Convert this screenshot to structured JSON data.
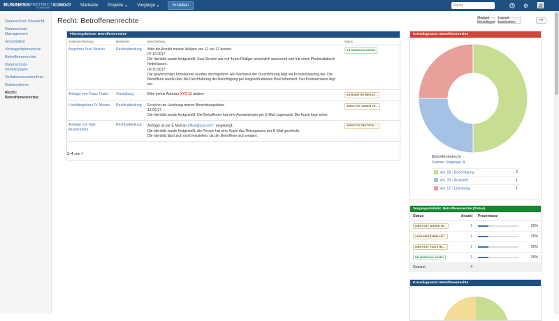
{
  "topbar": {
    "logo_main": "BUSINESS",
    "logo_thin": "PROTECT",
    "logo_sub": "by eXtrapolate",
    "brand": "KOMDAT",
    "nav": [
      {
        "label": "Startseite"
      },
      {
        "label": "Projekte"
      },
      {
        "label": "Vorgänge"
      }
    ],
    "create_label": "Erstellen",
    "search_placeholder": "Suche",
    "help_icon": "?",
    "settings_icon": "⚙"
  },
  "sidebar": {
    "items": [
      {
        "label": "Datenschutz Übersicht"
      },
      {
        "label": "Datenschutz-Management"
      },
      {
        "label": "Grundsätze"
      },
      {
        "label": "Vertragsdatenschutz"
      },
      {
        "label": "Betroffenenrechte"
      },
      {
        "label": "Datenschutz-Verletzungen"
      },
      {
        "label": "Verfahrensverzeichnis"
      },
      {
        "label": "Dateisysteme"
      },
      {
        "label": "Recht: Betroffenenrechte"
      }
    ]
  },
  "page": {
    "title": "Recht: Betroffenenrechte",
    "add_gadget": "Gadget hinzufügen",
    "edit_layout": "Layout bearbeiten",
    "more": "•••"
  },
  "filter_panel": {
    "title": "Filterergebnisse: Betroffenenrechte",
    "columns": [
      "Zusammenfassung",
      "Bearbeiter",
      "Beschreibung",
      "Status"
    ],
    "rows": [
      {
        "summary": "Begehren Susi Strolchi",
        "assignee": "Rechtsabteilung",
        "desc_lines": [
          "Bitte die Anzahl meiner Welpen von 12 auf 17 ändern.",
          "07.10.2017",
          "Die Identität wurde festgestellt. Susi Strolchi war mit Ihrem Rüdiger persönlich anwesend und hat einen Photonabdruck hinterlassen.",
          "09.10.2017",
          "Die gewünschten Korrekturen wurden durchgeführt. Als Nachweis der Durchführung liegt ein Protokollauszug bei. Die Betroffene wurde über die Durchführung der Berichtigung per eingeschriebenen Brief informiert. Der Postnachweis liegt bei."
        ],
        "status": "BR ABGESCHLOSSEN",
        "status_color": "green"
      },
      {
        "summary": "Anfrage von Franz Tester",
        "assignee": "Verwaltung",
        "desc_prefix": "Bitte meine Adresse ",
        "desc_highlight": "XYZ 12",
        "desc_suffix": " ändern",
        "status": "AUSKUNFTSTEMPLAT...",
        "status_color": "brown"
      },
      {
        "summary": "Löschbegehren Fr. Muster",
        "assignee": "Rechtsabteilung",
        "desc_lines": [
          "Ersuche um Löschung meiner Bewerbungsdaten",
          "12.09.17",
          "Die Identität wurde festgestellt. Die Betroffenen hat eine Ausweiskopie per E-Mail zugesandt. Die Kopie liegt anbei."
        ],
        "status": "IDENTITÄT WURDE FE...",
        "status_color": "brown"
      },
      {
        "summary": "Anfrage von Max Mustermann",
        "assignee": "Rechtsabteilung",
        "desc_prefix": "Anfrage ist per E-Mail an ",
        "desc_link": "office@xyz.com",
        "desc_suffix": " eingelangt.",
        "desc_lines": [
          "Die Identität wurde festgestellt, die Person hat eine Kopie des Reisepasses per E-Mail geschickt.",
          "Die Identität lässt sich nicht feststellen, da der Betroffene sich weigert."
        ],
        "status": "IDENTITÄT FESTSTEL...",
        "status_color": "brown"
      }
    ],
    "pager_range": "1–4",
    "pager_of": "von",
    "pager_total": "4"
  },
  "pie_panel": {
    "title": "Kreisdiagramm: Betroffenenrechte",
    "caption": "Betroffenenrecht",
    "sum_label": "Summe: Vorgänge:",
    "sum_value": "4"
  },
  "chart_data": {
    "type": "pie",
    "title": "Betroffenenrecht",
    "categories": [
      "Art. 16 - Berichtigung",
      "Art. 15 - Auskunft",
      "Art. 17 - Löschung"
    ],
    "values": [
      2,
      1,
      1
    ],
    "colors": [
      "#c7dd92",
      "#a3c2e4",
      "#e8a09a"
    ],
    "donut": true
  },
  "stats_panel": {
    "title": "Vorgangsstatistik: Betroffenenrechte (Status)",
    "columns": [
      "Status",
      "Anzahl",
      "Prozentsatz"
    ],
    "rows": [
      {
        "status": "IDENTITÄT WURDE FE...",
        "count": "1",
        "percent": "25%",
        "fraction": 0.25
      },
      {
        "status": "AUSKUNFTSTEMPLAT...",
        "count": "1",
        "percent": "25%",
        "fraction": 0.25
      },
      {
        "status": "IDENTITÄT FESTSTEL...",
        "count": "1",
        "percent": "25%",
        "fraction": 0.25
      },
      {
        "status": "BR ABGESCHLOSSEN",
        "count": "1",
        "percent": "25%",
        "fraction": 0.25
      }
    ],
    "total_label": "Gesamt",
    "total_value": "4"
  },
  "pie_panel2": {
    "title": "Kreisdiagramm: Betroffenenrechte",
    "colors": [
      "#c7dd92",
      "#f3dc95",
      "#fbeec7"
    ]
  },
  "colors": {
    "topbar": "#205081",
    "accent": "#3b73af",
    "red_header": "#d04437",
    "green_header": "#14892c",
    "blue_header": "#205081"
  }
}
